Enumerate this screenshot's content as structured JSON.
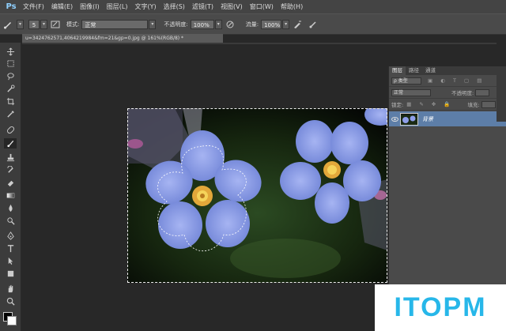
{
  "app": {
    "logo": "Ps"
  },
  "menu": [
    "文件(F)",
    "编辑(E)",
    "图像(I)",
    "图层(L)",
    "文字(Y)",
    "选择(S)",
    "滤镜(T)",
    "视图(V)",
    "窗口(W)",
    "帮助(H)"
  ],
  "options": {
    "brush_size": "5",
    "mode_label": "模式:",
    "mode_value": "正常",
    "opacity_label": "不透明度:",
    "opacity_value": "100%",
    "flow_label": "流量:",
    "flow_value": "100%"
  },
  "document": {
    "tab_title": "u=3424762571,4064219984&fm=21&gp=0.jpg @ 161%(RGB/8) *"
  },
  "tools": [
    "move-icon",
    "marquee-icon",
    "lasso-icon",
    "quick-select-icon",
    "crop-icon",
    "eyedropper-icon",
    "healing-icon",
    "brush-icon",
    "stamp-icon",
    "history-brush-icon",
    "eraser-icon",
    "gradient-icon",
    "blur-icon",
    "dodge-icon",
    "pen-icon",
    "type-icon",
    "path-select-icon",
    "shape-icon",
    "hand-icon",
    "zoom-icon"
  ],
  "layers_panel": {
    "tabs": [
      "图层",
      "路径",
      "通道"
    ],
    "filter_label": "ρ 类型",
    "blend_mode": "正常",
    "opacity_label": "不透明度:",
    "lock_label": "锁定:",
    "fill_label": "填充:",
    "layer_name": "背景"
  },
  "watermark": "ITOPM",
  "colors": {
    "menubar": "#444444",
    "panel": "#4a4a4a",
    "selected_layer": "#5d7ea8",
    "watermark": "#27b7e9"
  }
}
